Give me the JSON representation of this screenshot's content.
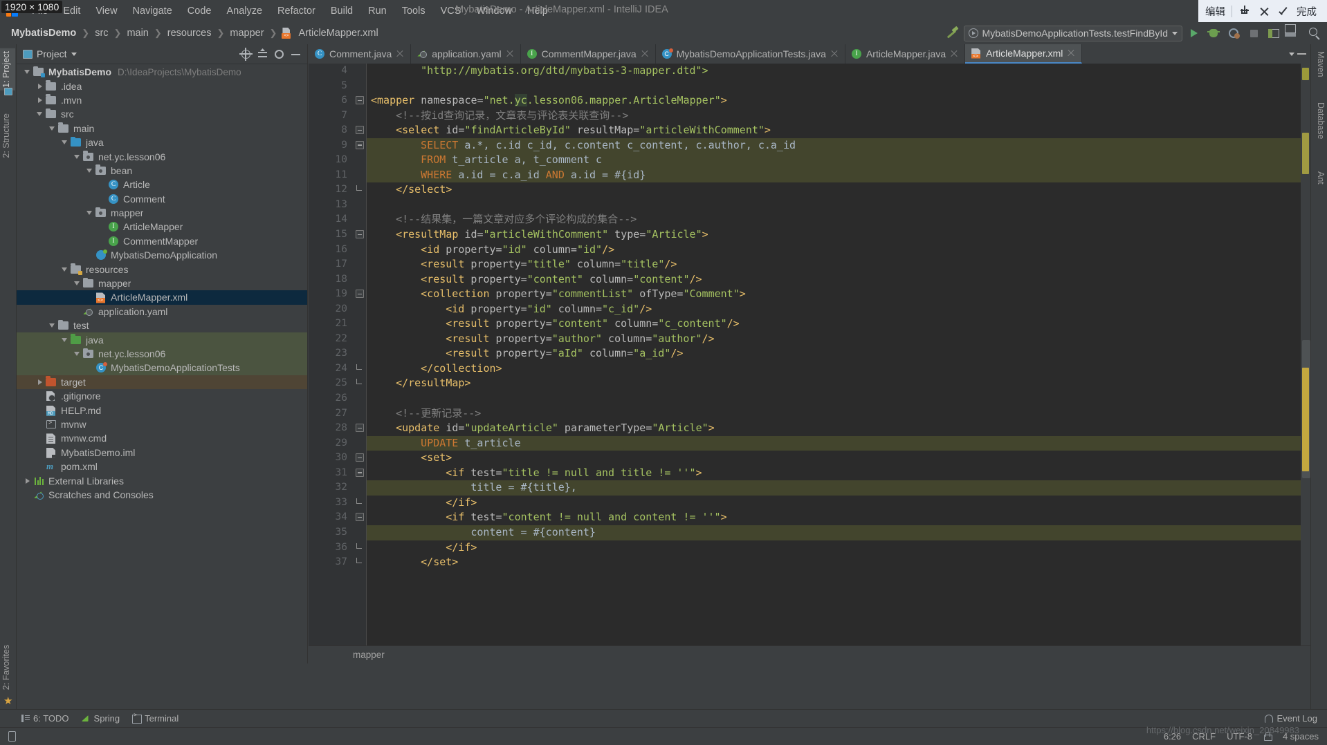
{
  "window": {
    "title": "MybatisDemo - ArticleMapper.xml - IntelliJ IDEA",
    "size_overlay": "1920 × 1080"
  },
  "menubar": {
    "items": [
      "File",
      "Edit",
      "View",
      "Navigate",
      "Code",
      "Analyze",
      "Refactor",
      "Build",
      "Run",
      "Tools",
      "VCS",
      "Window",
      "Help"
    ]
  },
  "capture_overlay": {
    "edit_label": "编辑",
    "done_label": "完成",
    "icons": [
      "download-icon",
      "close-icon",
      "check-icon"
    ]
  },
  "breadcrumb": {
    "project": "MybatisDemo",
    "segments": [
      "src",
      "main",
      "resources",
      "mapper"
    ],
    "file": "ArticleMapper.xml",
    "separator": "❯"
  },
  "toolbar": {
    "run_config": "MybatisDemoApplicationTests.testFindById",
    "buttons": [
      "hammer-icon",
      "run-icon",
      "debug-icon",
      "coverage-icon",
      "stop-icon",
      "layout-icon",
      "layout2-icon",
      "search-icon"
    ]
  },
  "left_strips": {
    "top": [
      "1: Project",
      "2: Structure"
    ],
    "bottom": [
      "2: Favorites"
    ]
  },
  "right_strips": {
    "items": [
      "Maven",
      "Database",
      "Ant"
    ]
  },
  "project_panel": {
    "title": "Project",
    "actions": [
      "locate-icon",
      "collapse-all-icon",
      "settings-icon",
      "hide-icon"
    ],
    "tree": [
      {
        "depth": 0,
        "arrow": "down",
        "icon": "module-folder",
        "label": "MybatisDemo",
        "bold": true,
        "sub": "D:\\IdeaProjects\\MybatisDemo"
      },
      {
        "depth": 1,
        "arrow": "right",
        "icon": "folder",
        "label": ".idea"
      },
      {
        "depth": 1,
        "arrow": "right",
        "icon": "folder",
        "label": ".mvn"
      },
      {
        "depth": 1,
        "arrow": "down",
        "icon": "folder",
        "label": "src"
      },
      {
        "depth": 2,
        "arrow": "down",
        "icon": "folder",
        "label": "main"
      },
      {
        "depth": 3,
        "arrow": "down",
        "icon": "folder-source",
        "label": "java"
      },
      {
        "depth": 4,
        "arrow": "down",
        "icon": "package",
        "label": "net.yc.lesson06"
      },
      {
        "depth": 5,
        "arrow": "down",
        "icon": "package",
        "label": "bean"
      },
      {
        "depth": 6,
        "arrow": "none",
        "icon": "class",
        "label": "Article"
      },
      {
        "depth": 6,
        "arrow": "none",
        "icon": "class",
        "label": "Comment"
      },
      {
        "depth": 5,
        "arrow": "down",
        "icon": "package",
        "label": "mapper"
      },
      {
        "depth": 6,
        "arrow": "none",
        "icon": "interface",
        "label": "ArticleMapper"
      },
      {
        "depth": 6,
        "arrow": "none",
        "icon": "interface",
        "label": "CommentMapper"
      },
      {
        "depth": 5,
        "arrow": "none",
        "icon": "spring-boot",
        "label": "MybatisDemoApplication"
      },
      {
        "depth": 3,
        "arrow": "down",
        "icon": "folder-resource",
        "label": "resources"
      },
      {
        "depth": 4,
        "arrow": "down",
        "icon": "folder",
        "label": "mapper"
      },
      {
        "depth": 5,
        "arrow": "none",
        "icon": "xml",
        "label": "ArticleMapper.xml",
        "selected": true
      },
      {
        "depth": 4,
        "arrow": "none",
        "icon": "yaml",
        "label": "application.yaml"
      },
      {
        "depth": 2,
        "arrow": "down",
        "icon": "folder",
        "label": "test"
      },
      {
        "depth": 3,
        "arrow": "down",
        "icon": "folder-test",
        "label": "java",
        "row_bg": "test"
      },
      {
        "depth": 4,
        "arrow": "down",
        "icon": "package",
        "label": "net.yc.lesson06",
        "row_bg": "test"
      },
      {
        "depth": 5,
        "arrow": "none",
        "icon": "spring-test",
        "label": "MybatisDemoApplicationTests",
        "row_bg": "test"
      },
      {
        "depth": 1,
        "arrow": "right",
        "icon": "folder-excluded",
        "label": "target",
        "row_bg": "excluded"
      },
      {
        "depth": 1,
        "arrow": "none",
        "icon": "gitignore",
        "label": ".gitignore"
      },
      {
        "depth": 1,
        "arrow": "none",
        "icon": "markdown",
        "label": "HELP.md"
      },
      {
        "depth": 1,
        "arrow": "none",
        "icon": "shell",
        "label": "mvnw"
      },
      {
        "depth": 1,
        "arrow": "none",
        "icon": "cmd",
        "label": "mvnw.cmd"
      },
      {
        "depth": 1,
        "arrow": "none",
        "icon": "iml",
        "label": "MybatisDemo.iml"
      },
      {
        "depth": 1,
        "arrow": "none",
        "icon": "pom",
        "label": "pom.xml"
      },
      {
        "depth": 0,
        "arrow": "right",
        "icon": "libraries",
        "label": "External Libraries"
      },
      {
        "depth": 0,
        "arrow": "none",
        "icon": "scratches",
        "label": "Scratches and Consoles"
      }
    ]
  },
  "editor": {
    "tabs": [
      {
        "label": "Comment.java",
        "icon": "class-icon",
        "active": false
      },
      {
        "label": "application.yaml",
        "icon": "yaml-icon",
        "active": false
      },
      {
        "label": "CommentMapper.java",
        "icon": "interface-icon",
        "active": false
      },
      {
        "label": "MybatisDemoApplicationTests.java",
        "icon": "spring-test-icon",
        "active": false
      },
      {
        "label": "ArticleMapper.java",
        "icon": "interface-icon",
        "active": false
      },
      {
        "label": "ArticleMapper.xml",
        "icon": "xml-icon",
        "active": true
      }
    ],
    "breadcrumb_bottom": "mapper",
    "first_line_number": 4,
    "lines": [
      {
        "n": 4,
        "indent": 8,
        "tokens": [
          {
            "t": "\"http://mybatis.org/dtd/mybatis-3-mapper.dtd\">",
            "c": "k-val"
          }
        ]
      },
      {
        "n": 5,
        "indent": 0,
        "tokens": []
      },
      {
        "n": 6,
        "indent": 0,
        "fold": "open",
        "tokens": [
          {
            "t": "<mapper ",
            "c": "k-tag"
          },
          {
            "t": "namespace=",
            "c": "k-attr"
          },
          {
            "t": "\"net.",
            "c": "k-val"
          },
          {
            "t": "yc",
            "c": "k-val hl-word"
          },
          {
            "t": ".lesson06.mapper.ArticleMapper\"",
            "c": "k-val"
          },
          {
            "t": ">",
            "c": "k-tag"
          }
        ]
      },
      {
        "n": 7,
        "indent": 4,
        "tokens": [
          {
            "t": "<!--按id查询记录，文章表与评论表关联查询-->",
            "c": "k-comment"
          }
        ]
      },
      {
        "n": 8,
        "indent": 4,
        "fold": "open",
        "tokens": [
          {
            "t": "<select ",
            "c": "k-tag"
          },
          {
            "t": "id=",
            "c": "k-attr"
          },
          {
            "t": "\"findArticleById\"",
            "c": "k-val"
          },
          {
            "t": " resultMap=",
            "c": "k-attr"
          },
          {
            "t": "\"articleWithComment\"",
            "c": "k-val"
          },
          {
            "t": ">",
            "c": "k-tag"
          }
        ]
      },
      {
        "n": 9,
        "indent": 8,
        "fold": "open",
        "sql": true,
        "tokens": [
          {
            "t": "SELECT",
            "c": "k-sql"
          },
          {
            "t": " a.*, c.id c_id, c.content c_content, c.author, c.a_id",
            "c": "k-txt"
          }
        ]
      },
      {
        "n": 10,
        "indent": 8,
        "sql": true,
        "tokens": [
          {
            "t": "FROM",
            "c": "k-sql"
          },
          {
            "t": " t_article a, t_comment c",
            "c": "k-txt"
          }
        ]
      },
      {
        "n": 11,
        "indent": 8,
        "sql": true,
        "tokens": [
          {
            "t": "WHERE",
            "c": "k-sql"
          },
          {
            "t": " a.id = c.a_id ",
            "c": "k-txt"
          },
          {
            "t": "AND",
            "c": "k-sql"
          },
          {
            "t": " a.id = #{id}",
            "c": "k-txt"
          }
        ]
      },
      {
        "n": 12,
        "indent": 4,
        "fold": "close",
        "tokens": [
          {
            "t": "</select>",
            "c": "k-tag"
          }
        ]
      },
      {
        "n": 13,
        "indent": 0,
        "tokens": []
      },
      {
        "n": 14,
        "indent": 4,
        "tokens": [
          {
            "t": "<!--结果集，一篇文章对应多个评论构成的集合-->",
            "c": "k-comment"
          }
        ]
      },
      {
        "n": 15,
        "indent": 4,
        "fold": "open",
        "tokens": [
          {
            "t": "<resultMap ",
            "c": "k-tag"
          },
          {
            "t": "id=",
            "c": "k-attr"
          },
          {
            "t": "\"articleWithComment\"",
            "c": "k-val"
          },
          {
            "t": " type=",
            "c": "k-attr"
          },
          {
            "t": "\"Article\"",
            "c": "k-val"
          },
          {
            "t": ">",
            "c": "k-tag"
          }
        ]
      },
      {
        "n": 16,
        "indent": 8,
        "tokens": [
          {
            "t": "<id ",
            "c": "k-tag"
          },
          {
            "t": "property=",
            "c": "k-attr"
          },
          {
            "t": "\"id\"",
            "c": "k-val"
          },
          {
            "t": " column=",
            "c": "k-attr"
          },
          {
            "t": "\"id\"",
            "c": "k-val"
          },
          {
            "t": "/>",
            "c": "k-tag"
          }
        ]
      },
      {
        "n": 17,
        "indent": 8,
        "tokens": [
          {
            "t": "<result ",
            "c": "k-tag"
          },
          {
            "t": "property=",
            "c": "k-attr"
          },
          {
            "t": "\"title\"",
            "c": "k-val"
          },
          {
            "t": " column=",
            "c": "k-attr"
          },
          {
            "t": "\"title\"",
            "c": "k-val"
          },
          {
            "t": "/>",
            "c": "k-tag"
          }
        ]
      },
      {
        "n": 18,
        "indent": 8,
        "tokens": [
          {
            "t": "<result ",
            "c": "k-tag"
          },
          {
            "t": "property=",
            "c": "k-attr"
          },
          {
            "t": "\"content\"",
            "c": "k-val"
          },
          {
            "t": " column=",
            "c": "k-attr"
          },
          {
            "t": "\"content\"",
            "c": "k-val"
          },
          {
            "t": "/>",
            "c": "k-tag"
          }
        ]
      },
      {
        "n": 19,
        "indent": 8,
        "fold": "open",
        "tokens": [
          {
            "t": "<collection ",
            "c": "k-tag"
          },
          {
            "t": "property=",
            "c": "k-attr"
          },
          {
            "t": "\"commentList\"",
            "c": "k-val"
          },
          {
            "t": " ofType=",
            "c": "k-attr"
          },
          {
            "t": "\"Comment\"",
            "c": "k-val"
          },
          {
            "t": ">",
            "c": "k-tag"
          }
        ]
      },
      {
        "n": 20,
        "indent": 12,
        "tokens": [
          {
            "t": "<id ",
            "c": "k-tag"
          },
          {
            "t": "property=",
            "c": "k-attr"
          },
          {
            "t": "\"id\"",
            "c": "k-val"
          },
          {
            "t": " column=",
            "c": "k-attr"
          },
          {
            "t": "\"c_id\"",
            "c": "k-val"
          },
          {
            "t": "/>",
            "c": "k-tag"
          }
        ]
      },
      {
        "n": 21,
        "indent": 12,
        "tokens": [
          {
            "t": "<result ",
            "c": "k-tag"
          },
          {
            "t": "property=",
            "c": "k-attr"
          },
          {
            "t": "\"content\"",
            "c": "k-val"
          },
          {
            "t": " column=",
            "c": "k-attr"
          },
          {
            "t": "\"c_content\"",
            "c": "k-val"
          },
          {
            "t": "/>",
            "c": "k-tag"
          }
        ]
      },
      {
        "n": 22,
        "indent": 12,
        "tokens": [
          {
            "t": "<result ",
            "c": "k-tag"
          },
          {
            "t": "property=",
            "c": "k-attr"
          },
          {
            "t": "\"author\"",
            "c": "k-val"
          },
          {
            "t": " column=",
            "c": "k-attr"
          },
          {
            "t": "\"author\"",
            "c": "k-val"
          },
          {
            "t": "/>",
            "c": "k-tag"
          }
        ]
      },
      {
        "n": 23,
        "indent": 12,
        "tokens": [
          {
            "t": "<result ",
            "c": "k-tag"
          },
          {
            "t": "property=",
            "c": "k-attr"
          },
          {
            "t": "\"aId\"",
            "c": "k-val"
          },
          {
            "t": " column=",
            "c": "k-attr"
          },
          {
            "t": "\"a_id\"",
            "c": "k-val"
          },
          {
            "t": "/>",
            "c": "k-tag"
          }
        ]
      },
      {
        "n": 24,
        "indent": 8,
        "fold": "close",
        "tokens": [
          {
            "t": "</collection>",
            "c": "k-tag"
          }
        ]
      },
      {
        "n": 25,
        "indent": 4,
        "fold": "close",
        "tokens": [
          {
            "t": "</resultMap>",
            "c": "k-tag"
          }
        ]
      },
      {
        "n": 26,
        "indent": 0,
        "tokens": []
      },
      {
        "n": 27,
        "indent": 4,
        "tokens": [
          {
            "t": "<!--更新记录-->",
            "c": "k-comment"
          }
        ]
      },
      {
        "n": 28,
        "indent": 4,
        "fold": "open",
        "tokens": [
          {
            "t": "<update ",
            "c": "k-tag"
          },
          {
            "t": "id=",
            "c": "k-attr"
          },
          {
            "t": "\"updateArticle\"",
            "c": "k-val"
          },
          {
            "t": " parameterType=",
            "c": "k-attr"
          },
          {
            "t": "\"Article\"",
            "c": "k-val"
          },
          {
            "t": ">",
            "c": "k-tag"
          }
        ]
      },
      {
        "n": 29,
        "indent": 8,
        "sql": true,
        "tokens": [
          {
            "t": "UPDATE",
            "c": "k-sql"
          },
          {
            "t": " t_article",
            "c": "k-txt"
          }
        ]
      },
      {
        "n": 30,
        "indent": 8,
        "fold": "open",
        "tokens": [
          {
            "t": "<set>",
            "c": "k-tag"
          }
        ]
      },
      {
        "n": 31,
        "indent": 12,
        "fold": "open",
        "tokens": [
          {
            "t": "<if ",
            "c": "k-tag"
          },
          {
            "t": "test=",
            "c": "k-attr"
          },
          {
            "t": "\"title != null and title != ''\"",
            "c": "k-val"
          },
          {
            "t": ">",
            "c": "k-tag"
          }
        ]
      },
      {
        "n": 32,
        "indent": 16,
        "sql": true,
        "tokens": [
          {
            "t": "title = #{title},",
            "c": "k-txt"
          }
        ]
      },
      {
        "n": 33,
        "indent": 12,
        "fold": "close",
        "tokens": [
          {
            "t": "</if>",
            "c": "k-tag"
          }
        ]
      },
      {
        "n": 34,
        "indent": 12,
        "fold": "open",
        "tokens": [
          {
            "t": "<if ",
            "c": "k-tag"
          },
          {
            "t": "test=",
            "c": "k-attr"
          },
          {
            "t": "\"content != null and content != ''\"",
            "c": "k-val"
          },
          {
            "t": ">",
            "c": "k-tag"
          }
        ]
      },
      {
        "n": 35,
        "indent": 16,
        "sql": true,
        "tokens": [
          {
            "t": "content = #{content}",
            "c": "k-txt"
          }
        ]
      },
      {
        "n": 36,
        "indent": 12,
        "fold": "close",
        "tokens": [
          {
            "t": "</if>",
            "c": "k-tag"
          }
        ]
      },
      {
        "n": 37,
        "indent": 8,
        "fold": "close",
        "tokens": [
          {
            "t": "</set>",
            "c": "k-tag"
          }
        ]
      }
    ]
  },
  "bottom_bar": {
    "items": [
      {
        "label": "6: TODO",
        "icon": "todo-icon"
      },
      {
        "label": "Spring",
        "icon": "spring-icon"
      },
      {
        "label": "Terminal",
        "icon": "terminal-icon"
      }
    ],
    "event_log": "Event Log"
  },
  "statusbar": {
    "position": "6:26",
    "line_sep": "CRLF",
    "encoding": "UTF-8",
    "indent": "4 spaces",
    "watermark": "https://blog.csdn.net/weixin_20849983"
  }
}
